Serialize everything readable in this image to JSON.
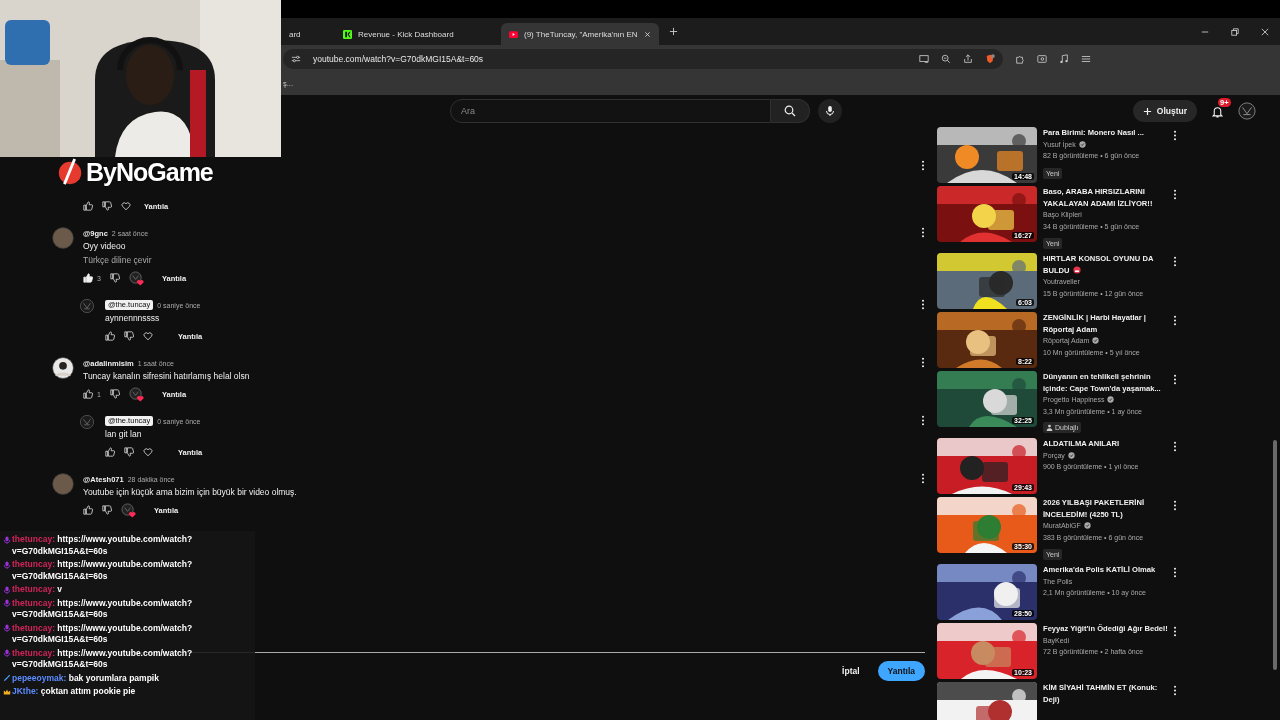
{
  "browser": {
    "tabs": [
      {
        "title": "ard",
        "selected": false
      },
      {
        "title": "Revenue - Kick Dashboard",
        "selected": false
      },
      {
        "title": "(9) TheTuncay, \"Amerika'nın EN",
        "selected": true
      }
    ],
    "url": "youtube.com/watch?v=G70dkMGI15A&t=60s",
    "bookmark": "ş..."
  },
  "header": {
    "search_placeholder": "Ara",
    "create_label": "Oluştur",
    "notification_count": "9+"
  },
  "comments": [
    {
      "kind": "actions_only",
      "liked": false,
      "hearted": false,
      "reply_label": "Yantıla"
    },
    {
      "kind": "full",
      "author": "@9gnc",
      "creator": false,
      "time": "2 saat önce",
      "text": "Oyy videoo",
      "translate": "Türkçe diline çevir",
      "liked": true,
      "likes": "3",
      "hearted": true,
      "reply_label": "Yantıla",
      "children": [
        {
          "kind": "full",
          "author": "@the.tuncay",
          "creator": true,
          "time": "0 saniye önce",
          "text": "aynnennnssss",
          "liked": false,
          "hearted": false,
          "reply_label": "Yantıla"
        }
      ]
    },
    {
      "kind": "full",
      "author": "@adalinmisim",
      "creator": false,
      "time": "1 saat önce",
      "text": "Tuncay kanalın sifresini hatırlamış helal olsn",
      "liked": false,
      "likes": "1",
      "hearted": true,
      "reply_label": "Yantıla",
      "children": [
        {
          "kind": "full",
          "author": "@the.tuncay",
          "creator": true,
          "time": "0 saniye önce",
          "text": "lan git lan",
          "liked": false,
          "hearted": false,
          "reply_label": "Yantıla"
        }
      ]
    },
    {
      "kind": "full",
      "author": "@Atesh071",
      "creator": false,
      "time": "28 dakika önce",
      "text": "Youtube için küçük ama bizim için büyük bir video olmuş.",
      "liked": false,
      "hearted": true,
      "reply_label": "Yantıla"
    }
  ],
  "reply_box": {
    "cancel_label": "İptal",
    "submit_label": "Yantıla"
  },
  "videos": [
    {
      "title": "Para Birimi: Monero Nasıl ...",
      "channel": "Yusuf İpek",
      "verified": true,
      "emoji": false,
      "meta": "82 B görüntüleme • 6 gün önce",
      "badge": {
        "kind": "new",
        "label": "Yeni"
      },
      "duration": "14:48"
    },
    {
      "title": "Baso, ARABA HIRSIZLARINI YAKALAYAN ADAMI İZLİYOR!!",
      "channel": "Başo Klipleri",
      "verified": false,
      "emoji": false,
      "meta": "34 B görüntüleme • 5 gün önce",
      "badge": {
        "kind": "new",
        "label": "Yeni"
      },
      "duration": "16:27"
    },
    {
      "title": "HIRTLAR KONSOL OYUNU DA BULDU",
      "channel": "Youtraveller",
      "verified": false,
      "emoji": true,
      "meta": "15 B görüntüleme • 12 gün önce",
      "duration": "6:03"
    },
    {
      "title": "ZENGİNLİK | Harbi Hayatlar | Röportaj Adam",
      "channel": "Röportaj Adam",
      "verified": true,
      "emoji": false,
      "meta": "10 Mn görüntüleme • 5 yıl önce",
      "duration": "8:22"
    },
    {
      "title": "Dünyanın en tehlikeli şehrinin içinde: Cape Town'da yaşamak...",
      "channel": "Progetto Happiness",
      "verified": true,
      "emoji": false,
      "meta": "3,3 Mn görüntüleme • 1 ay önce",
      "badge": {
        "kind": "dubbed",
        "label": "Dublajlı"
      },
      "duration": "32:25"
    },
    {
      "title": "ALDATILMA ANILARI",
      "channel": "Porçay",
      "verified": true,
      "emoji": false,
      "meta": "900 B görüntüleme • 1 yıl önce",
      "duration": "29:43"
    },
    {
      "title": "2026 YILBAŞI PAKETLERİNİ İNCELEDİM! (4250 TL)",
      "channel": "MuratAbiGF",
      "verified": true,
      "emoji": false,
      "meta": "383 B görüntüleme • 6 gün önce",
      "badge": {
        "kind": "new",
        "label": "Yeni"
      },
      "duration": "35:30"
    },
    {
      "title": "Amerika'da Polis KATİLİ Olmak",
      "channel": "The Polis",
      "verified": false,
      "emoji": false,
      "meta": "2,1 Mn görüntüleme • 10 ay önce",
      "duration": "28:50"
    },
    {
      "title": "Feyyaz Yiğit'in Ödediği Ağır Bedel!",
      "channel": "BayKedi",
      "verified": false,
      "emoji": false,
      "meta": "72 B görüntüleme • 2 hafta önce",
      "duration": "10:23"
    },
    {
      "title": "KİM SİYAHİ TAHMİN ET (Konuk: Deji)",
      "emoji": false
    }
  ],
  "overlay": {
    "logo": "ByNoGame",
    "chat": [
      {
        "kind": "mic",
        "user": "thetuncay:",
        "color": "#d0245a",
        "text": "https://www.youtube.com/watch?v=G70dkMGI15A&t=60s"
      },
      {
        "kind": "mic",
        "user": "thetuncay:",
        "color": "#d0245a",
        "text": "https://www.youtube.com/watch?v=G70dkMGI15A&t=60s"
      },
      {
        "kind": "mic",
        "user": "thetuncay:",
        "color": "#d0245a",
        "text": "v"
      },
      {
        "kind": "mic",
        "user": "thetuncay:",
        "color": "#d0245a",
        "text": "https://www.youtube.com/watch?v=G70dkMGI15A&t=60s"
      },
      {
        "kind": "mic",
        "user": "thetuncay:",
        "color": "#d0245a",
        "text": "https://www.youtube.com/watch?v=G70dkMGI15A&t=60s"
      },
      {
        "kind": "mic",
        "user": "thetuncay:",
        "color": "#d0245a",
        "text": "https://www.youtube.com/watch?v=G70dkMGI15A&t=60s"
      },
      {
        "kind": "pen",
        "user": "pepeeoymak:",
        "color": "#5b8cff",
        "text": "bak yorumlara pampik"
      },
      {
        "kind": "crown",
        "user": "JKthe:",
        "color": "#5b8cff",
        "text": "çoktan attım pookie pie"
      }
    ]
  }
}
